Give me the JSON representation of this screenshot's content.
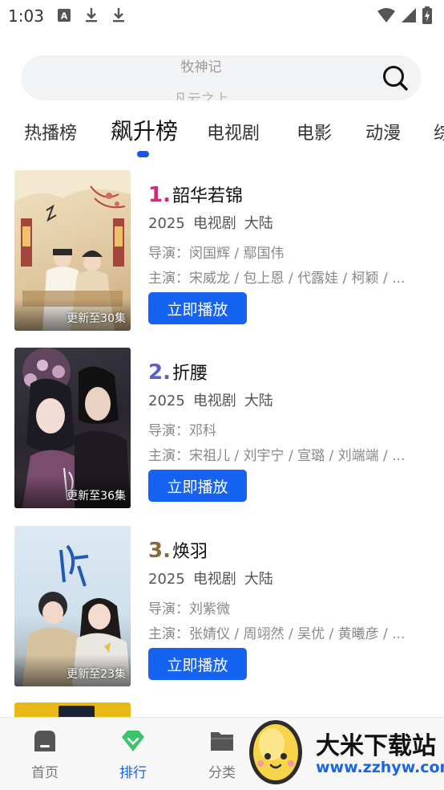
{
  "status_bar": {
    "time": "1:03",
    "left_icons": [
      "font-a-icon",
      "download-icon",
      "download-icon"
    ],
    "right_icons": [
      "wifi-icon",
      "signal-icon",
      "battery-charging-icon"
    ]
  },
  "search": {
    "hint_current": "牧神记",
    "hint_next": "凡云之上"
  },
  "tabs": [
    {
      "label": "热播榜",
      "active": false
    },
    {
      "label": "飙升榜",
      "active": true
    },
    {
      "label": "电视剧",
      "active": false
    },
    {
      "label": "电影",
      "active": false
    },
    {
      "label": "动漫",
      "active": false
    },
    {
      "label": "综",
      "active": false
    }
  ],
  "accent_color": "#1563f0",
  "items": [
    {
      "rank": "1.",
      "rank_color": "#c9307a",
      "title": "韶华若锦",
      "year": "2025",
      "type": "电视剧",
      "region": "大陆",
      "director": "导演：闵国辉 / 鄢国伟",
      "cast": "主演：宋威龙 / 包上恩 / 代露娃 / 柯颖 / ...",
      "badge": "更新至30集",
      "button": "立即播放"
    },
    {
      "rank": "2.",
      "rank_color": "#5b5fc7",
      "title": "折腰",
      "year": "2025",
      "type": "电视剧",
      "region": "大陆",
      "director": "导演：邓科",
      "cast": "主演：宋祖儿 / 刘宇宁 / 宣璐 / 刘端端 / ...",
      "badge": "更新至36集",
      "button": "立即播放"
    },
    {
      "rank": "3.",
      "rank_color": "#8a6a3c",
      "title": "焕羽",
      "year": "2025",
      "type": "电视剧",
      "region": "大陆",
      "director": "导演：刘紫微",
      "cast": "主演：张婧仪 / 周翊然 / 吴优 / 黄曦彦 / ...",
      "badge": "更新至23集",
      "button": "立即播放"
    }
  ],
  "bottom_nav": [
    {
      "label": "首页",
      "icon": "home-icon",
      "active": false
    },
    {
      "label": "排行",
      "icon": "diamond-icon",
      "active": true
    },
    {
      "label": "分类",
      "icon": "folder-icon",
      "active": false
    }
  ],
  "watermark": {
    "name": "大米下载站",
    "url": "www.zzhyw.com"
  }
}
